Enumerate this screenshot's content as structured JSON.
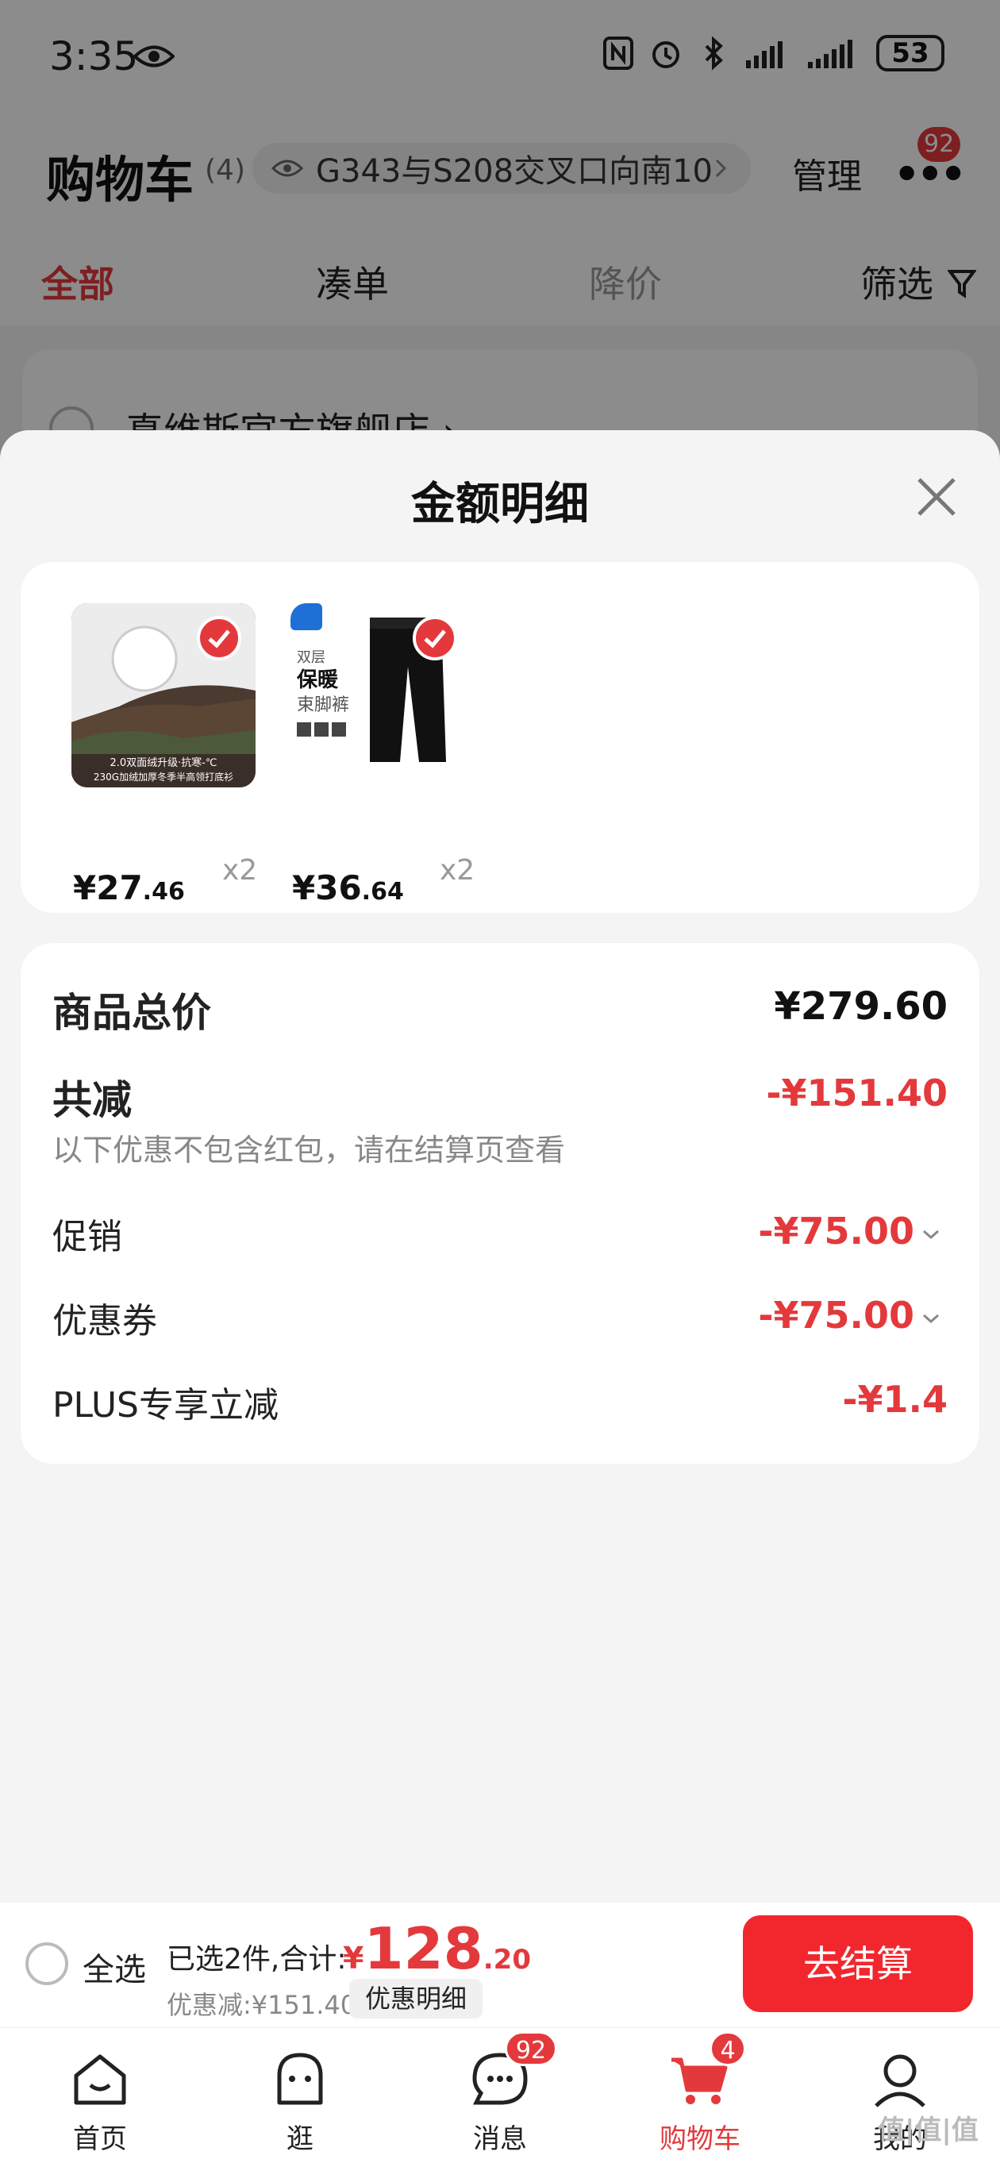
{
  "status_bar": {
    "time": "3:35",
    "battery": "53"
  },
  "header": {
    "title": "购物车",
    "count": "(4)",
    "address": "G343与S208交叉口向南10...",
    "manage": "管理",
    "more_badge": "92"
  },
  "tabs": [
    "全部",
    "凑单",
    "降价",
    "筛选"
  ],
  "store": {
    "name": "真维斯官方旗舰店 ›"
  },
  "sheet": {
    "title": "金额明细",
    "products": [
      {
        "price_int": "¥27",
        "price_dec": ".46",
        "qty": "x2",
        "caption1": "2.0双面绒升级·抗寒-℃",
        "caption2": "230G加绒加厚冬季半高领打底衫"
      },
      {
        "price_int": "¥36",
        "price_dec": ".64",
        "qty": "x2",
        "tag1": "双层",
        "tag2": "保暖",
        "tag3": "束脚裤"
      }
    ],
    "summary": {
      "total_label": "商品总价",
      "total_value": "¥279.60",
      "reduce_label": "共减",
      "reduce_value": "-¥151.40",
      "reduce_note": "以下优惠不包含红包，请在结算页查看",
      "promo_label": "促销",
      "promo_value": "-¥75.00",
      "coupon_label": "优惠券",
      "coupon_value": "-¥75.00",
      "plus_label": "PLUS专享立减",
      "plus_value": "-¥1.4"
    }
  },
  "checkout": {
    "select_all": "全选",
    "selected": "已选2件,合计:",
    "yen": "¥",
    "total_int": "128",
    "total_dec": ".20",
    "discount": "优惠减:¥151.40",
    "detail": "优惠明细",
    "pay": "去结算"
  },
  "nav": {
    "items": [
      {
        "label": "首页"
      },
      {
        "label": "逛"
      },
      {
        "label": "消息",
        "badge": "92"
      },
      {
        "label": "购物车",
        "badge": "4"
      },
      {
        "label": "我的"
      }
    ]
  },
  "watermark": "值|值|值",
  "colors": {
    "accent": "#e4393c",
    "pay": "#f2272e"
  }
}
